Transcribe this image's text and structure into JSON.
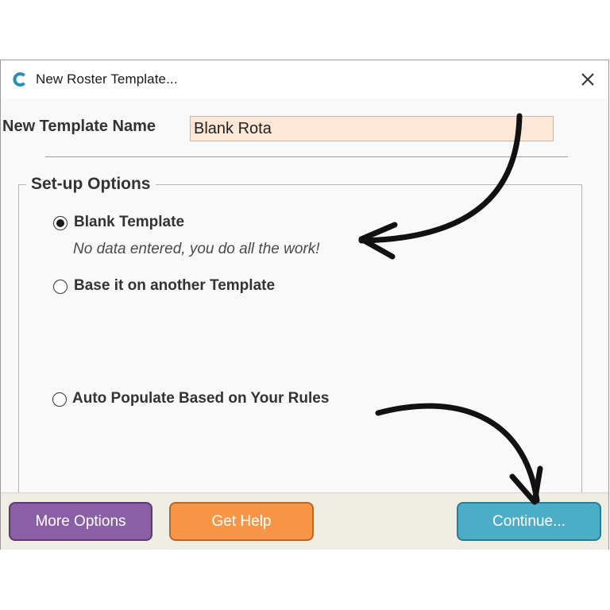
{
  "window": {
    "title": "New Roster Template...",
    "app_icon": "c-logo-icon",
    "close_icon": "close-icon"
  },
  "template_name": {
    "label": "New Template Name",
    "value": "Blank Rota"
  },
  "setup_options": {
    "legend": "Set-up Options",
    "options": [
      {
        "label": "Blank Template",
        "description": "No data entered, you do all the work!",
        "checked": true
      },
      {
        "label": "Base it on another Template",
        "checked": false
      },
      {
        "label": "Auto Populate Based on Your Rules",
        "checked": false
      }
    ]
  },
  "footer": {
    "more_options": "More Options",
    "get_help": "Get Help",
    "continue": "Continue..."
  },
  "colors": {
    "more_options": "#8a5fa6",
    "get_help": "#f79646",
    "continue": "#4badc6",
    "name_input_bg": "#fde7d6",
    "app_icon": "#2a8fb5"
  },
  "annotations": {
    "arrow_icon": "curved-arrow-icon"
  }
}
